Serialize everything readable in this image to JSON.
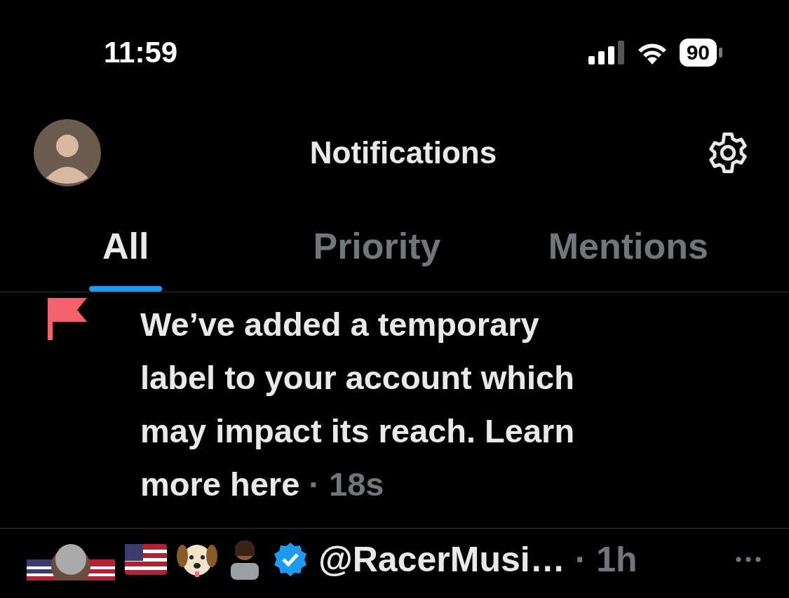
{
  "status_bar": {
    "time": "11:59",
    "battery": "90"
  },
  "header": {
    "title": "Notifications"
  },
  "tabs": [
    {
      "label": "All",
      "selected": true
    },
    {
      "label": "Priority",
      "selected": false
    },
    {
      "label": "Mentions",
      "selected": false
    }
  ],
  "notifications": [
    {
      "kind": "alert",
      "text": "We’ve added a temporary label to your account which may impact its reach. Learn more here",
      "time": "· 18s"
    },
    {
      "kind": "post",
      "handle": "@RacerMusi…",
      "time": "· 1h",
      "verified": true
    }
  ]
}
